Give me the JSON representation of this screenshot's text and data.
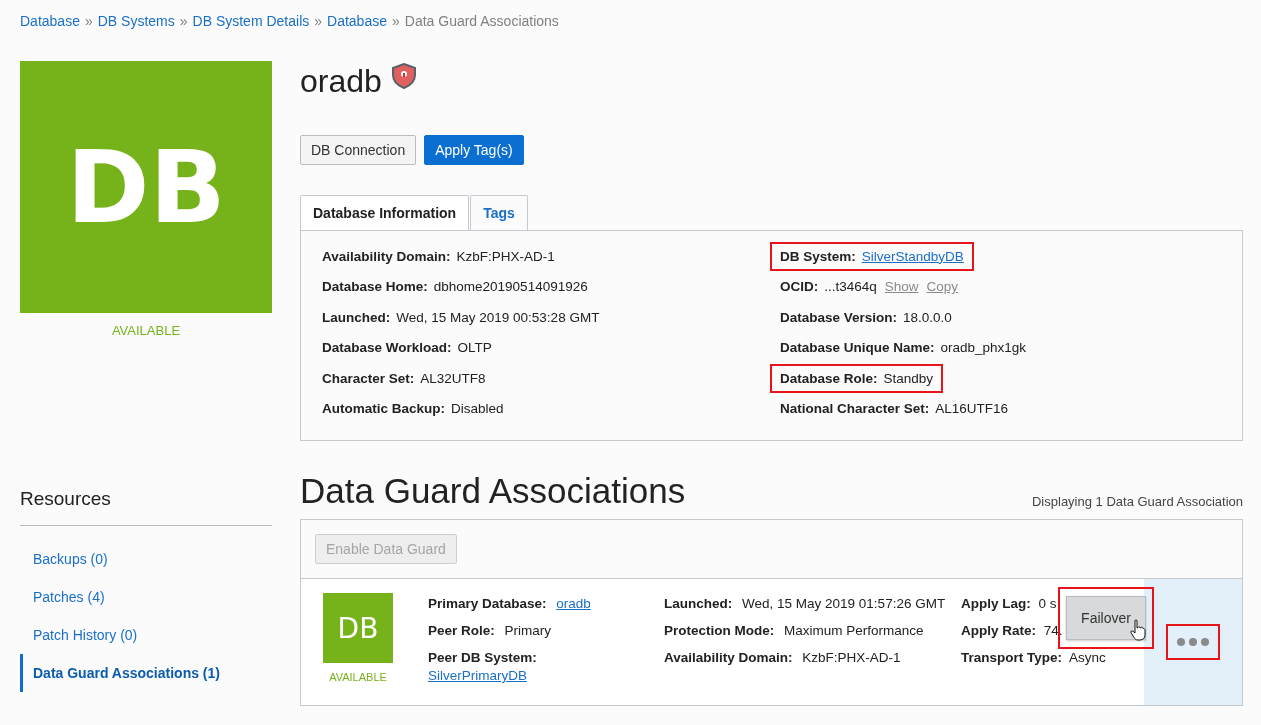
{
  "breadcrumb": [
    {
      "label": "Database",
      "link": true
    },
    {
      "label": "DB Systems",
      "link": true
    },
    {
      "label": "DB System Details",
      "link": true
    },
    {
      "label": "Database",
      "link": true
    },
    {
      "label": "Data Guard Associations",
      "link": false
    }
  ],
  "breadcrumb_separator": "»",
  "resource_tile": {
    "text": "DB",
    "status": "AVAILABLE"
  },
  "title": "oradb",
  "buttons": [
    {
      "label": "DB Connection",
      "kind": "default"
    },
    {
      "label": "Apply Tag(s)",
      "kind": "primary"
    }
  ],
  "tabs": [
    {
      "label": "Database Information",
      "selected": true
    },
    {
      "label": "Tags",
      "selected": false
    }
  ],
  "info_left": [
    {
      "label": "Availability Domain:",
      "value": "KzbF:PHX-AD-1"
    },
    {
      "label": "Database Home:",
      "value": "dbhome20190514091926"
    },
    {
      "label": "Launched:",
      "value": "Wed, 15 May 2019 00:53:28 GMT"
    },
    {
      "label": "Database Workload:",
      "value": "OLTP"
    },
    {
      "label": "Character Set:",
      "value": "AL32UTF8"
    },
    {
      "label": "Automatic Backup:",
      "value": "Disabled"
    }
  ],
  "info_right": [
    {
      "label": "DB System:",
      "value": "SilverStandbyDB",
      "kind": "link",
      "highlighted": true
    },
    {
      "label": "OCID:",
      "value": "...t3464q",
      "kind": "ocid",
      "actions": [
        "Show",
        "Copy"
      ],
      "highlighted": false
    },
    {
      "label": "Database Version:",
      "value": "18.0.0.0",
      "kind": "text",
      "highlighted": false
    },
    {
      "label": "Database Unique Name:",
      "value": "oradb_phx1gk",
      "kind": "text",
      "highlighted": false
    },
    {
      "label": "Database Role:",
      "value": "Standby",
      "kind": "text",
      "highlighted": true
    },
    {
      "label": "National Character Set:",
      "value": "AL16UTF16",
      "kind": "text",
      "highlighted": false
    }
  ],
  "resources": {
    "heading": "Resources",
    "items": [
      {
        "label": "Backups (0)",
        "selected": false
      },
      {
        "label": "Patches (4)",
        "selected": false
      },
      {
        "label": "Patch History (0)",
        "selected": false
      },
      {
        "label": "Data Guard Associations (1)",
        "selected": true
      }
    ]
  },
  "section": {
    "heading": "Data Guard Associations",
    "count_text": "Displaying 1 Data Guard Association",
    "enable_button": {
      "label": "Enable Data Guard",
      "disabled": true
    }
  },
  "association": {
    "tile": {
      "text": "DB",
      "status": "AVAILABLE"
    },
    "columns": [
      [
        {
          "label": "Primary Database:",
          "value": "oradb",
          "kind": "link"
        },
        {
          "label": "Peer Role:",
          "value": "Primary",
          "kind": "text"
        },
        {
          "label": "Peer DB System:",
          "value": "SilverPrimaryDB",
          "kind": "link-below"
        }
      ],
      [
        {
          "label": "Launched:",
          "value": "Wed, 15 May 2019 01:57:26 GMT",
          "kind": "text"
        },
        {
          "label": "Protection Mode:",
          "value": "Maximum Performance",
          "kind": "text"
        },
        {
          "label": "Availability Domain:",
          "value": "KzbF:PHX-AD-1",
          "kind": "text"
        }
      ],
      [
        {
          "label": "Apply Lag:",
          "value": "0 s",
          "kind": "text"
        },
        {
          "label": "Apply Rate:",
          "value": "74.",
          "kind": "text"
        },
        {
          "label": "Transport Type:",
          "value": "Async",
          "kind": "text"
        }
      ]
    ],
    "menu": {
      "item": "Failover",
      "highlighted": true
    },
    "actions_button": {
      "highlighted": true
    }
  }
}
